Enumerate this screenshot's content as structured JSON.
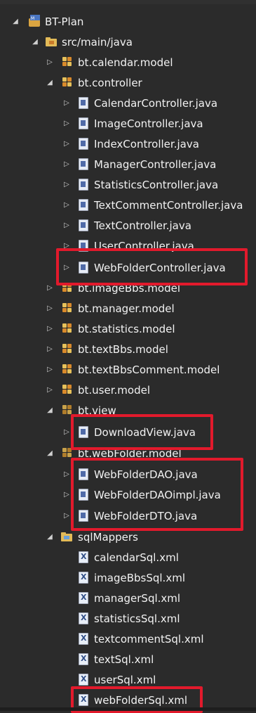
{
  "tree": {
    "nodes": [
      {
        "label": "BT-Plan",
        "type": "project",
        "expanded": true
      },
      {
        "label": "src/main/java",
        "type": "source-folder",
        "expanded": true
      },
      {
        "label": "bt.calendar.model",
        "type": "package",
        "expanded": false
      },
      {
        "label": "bt.controller",
        "type": "package",
        "expanded": true
      },
      {
        "label": "CalendarController.java",
        "type": "java"
      },
      {
        "label": "ImageController.java",
        "type": "java"
      },
      {
        "label": "IndexController.java",
        "type": "java"
      },
      {
        "label": "ManagerController.java",
        "type": "java"
      },
      {
        "label": "StatisticsController.java",
        "type": "java"
      },
      {
        "label": "TextCommentController.java",
        "type": "java"
      },
      {
        "label": "TextController.java",
        "type": "java"
      },
      {
        "label": "UserController.java",
        "type": "java"
      },
      {
        "label": "WebFolderController.java",
        "type": "java"
      },
      {
        "label": "bt.imageBbs.model",
        "type": "package",
        "expanded": false
      },
      {
        "label": "bt.manager.model",
        "type": "package",
        "expanded": false
      },
      {
        "label": "bt.statistics.model",
        "type": "package",
        "expanded": false
      },
      {
        "label": "bt.textBbs.model",
        "type": "package",
        "expanded": false
      },
      {
        "label": "bt.textBbsComment.model",
        "type": "package",
        "expanded": false
      },
      {
        "label": "bt.user.model",
        "type": "package",
        "expanded": false
      },
      {
        "label": "bt.view",
        "type": "package",
        "expanded": true
      },
      {
        "label": "DownloadView.java",
        "type": "java"
      },
      {
        "label": "bt.webFolder.model",
        "type": "package",
        "expanded": true
      },
      {
        "label": "WebFolderDAO.java",
        "type": "java"
      },
      {
        "label": "WebFolderDAOimpl.java",
        "type": "java"
      },
      {
        "label": "WebFolderDTO.java",
        "type": "java"
      },
      {
        "label": "sqlMappers",
        "type": "folder",
        "expanded": true
      },
      {
        "label": "calendarSql.xml",
        "type": "xml"
      },
      {
        "label": "imageBbsSql.xml",
        "type": "xml"
      },
      {
        "label": "managerSql.xml",
        "type": "xml"
      },
      {
        "label": "statisticsSql.xml",
        "type": "xml"
      },
      {
        "label": "textcommentSql.xml",
        "type": "xml"
      },
      {
        "label": "textSql.xml",
        "type": "xml"
      },
      {
        "label": "userSql.xml",
        "type": "xml"
      },
      {
        "label": "webFolderSql.xml",
        "type": "xml"
      }
    ]
  },
  "colors": {
    "background": "#2b2b2b",
    "text": "#f2f2f2",
    "highlight": "#e21a2c",
    "package_orange": "#d98a2b",
    "package_yellow": "#e7c15a"
  }
}
